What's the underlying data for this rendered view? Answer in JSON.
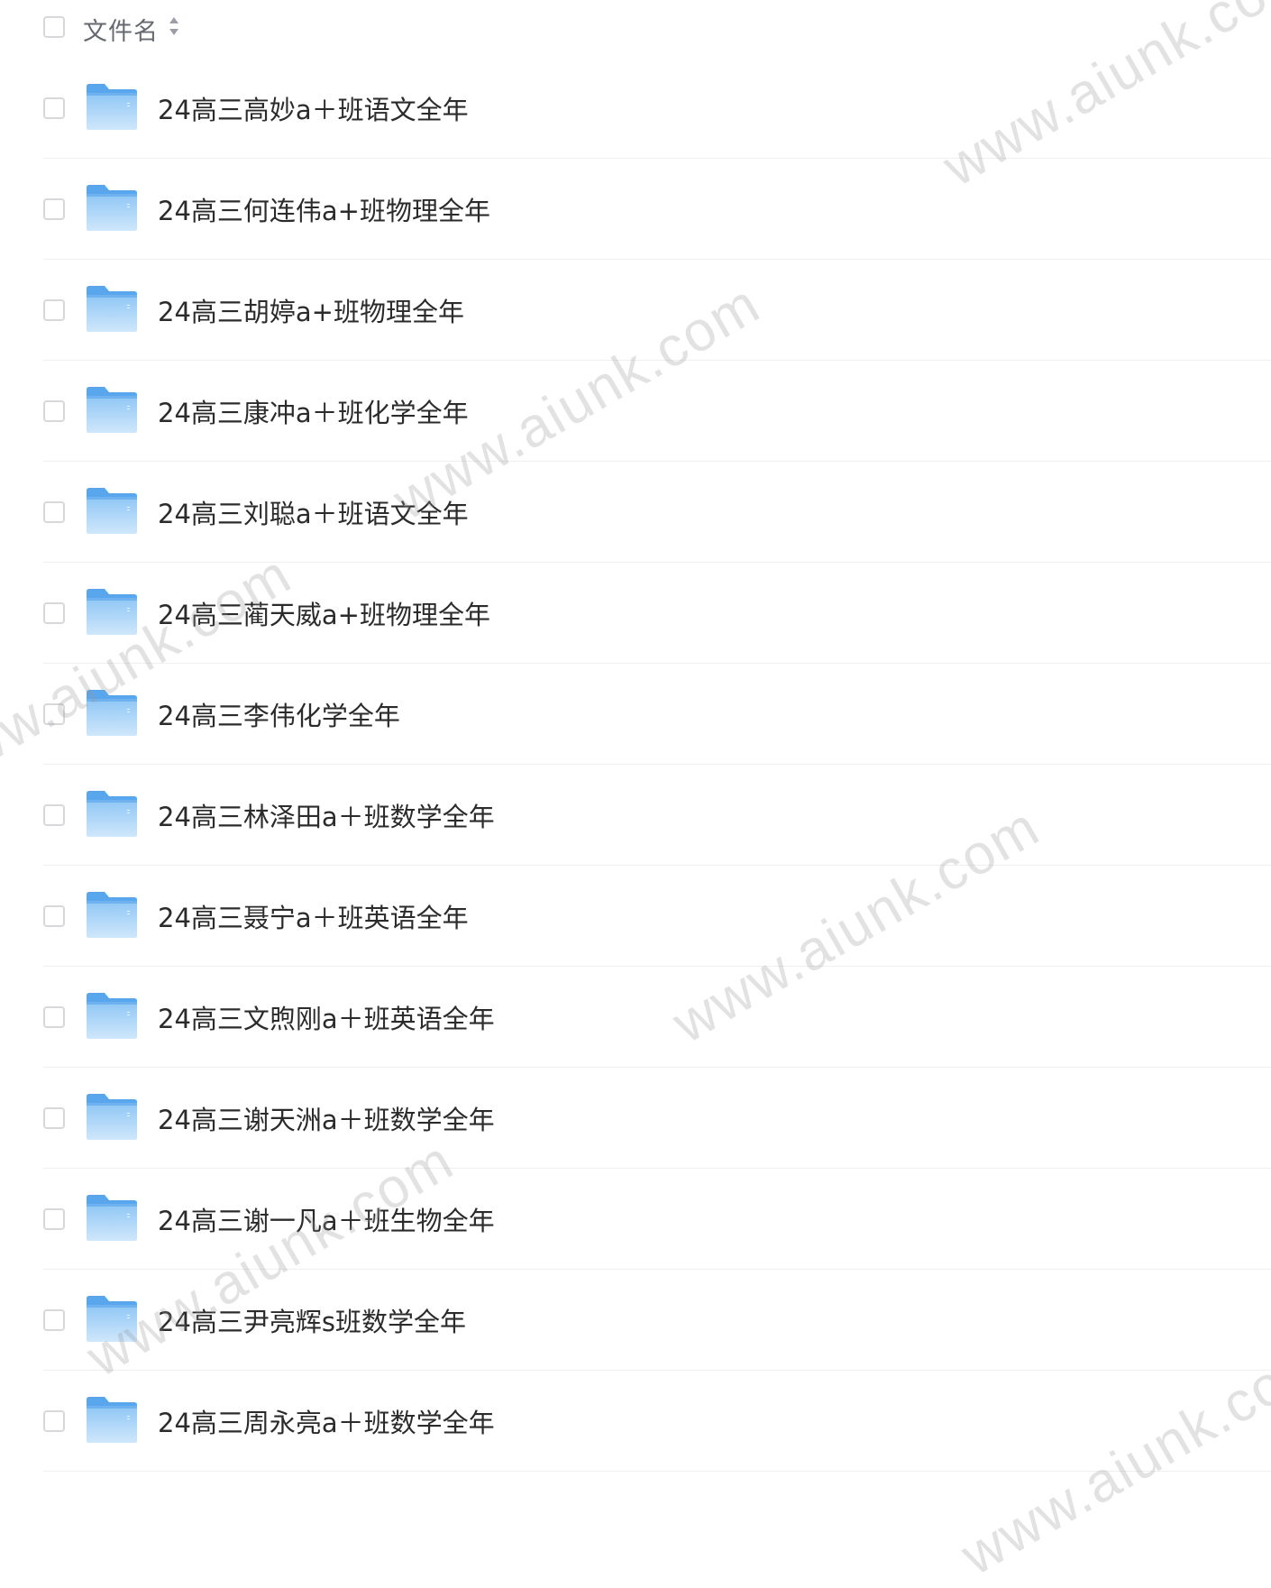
{
  "header": {
    "column_label": "文件名",
    "sort_icon": "sort-icon"
  },
  "files": [
    {
      "name": "24高三高妙a＋班语文全年",
      "icon": "folder-icon"
    },
    {
      "name": "24高三何连伟a+班物理全年",
      "icon": "folder-icon"
    },
    {
      "name": "24高三胡婷a+班物理全年",
      "icon": "folder-icon"
    },
    {
      "name": "24高三康冲a＋班化学全年",
      "icon": "folder-icon"
    },
    {
      "name": "24高三刘聪a＋班语文全年",
      "icon": "folder-icon"
    },
    {
      "name": "24高三蔺天威a+班物理全年",
      "icon": "folder-icon"
    },
    {
      "name": "24高三李伟化学全年",
      "icon": "folder-icon"
    },
    {
      "name": "24高三林泽田a＋班数学全年",
      "icon": "folder-icon"
    },
    {
      "name": "24高三聂宁a＋班英语全年",
      "icon": "folder-icon"
    },
    {
      "name": "24高三文煦刚a＋班英语全年",
      "icon": "folder-icon"
    },
    {
      "name": "24高三谢天洲a＋班数学全年",
      "icon": "folder-icon"
    },
    {
      "name": "24高三谢一凡a＋班生物全年",
      "icon": "folder-icon"
    },
    {
      "name": "24高三尹亮辉s班数学全年",
      "icon": "folder-icon"
    },
    {
      "name": "24高三周永亮a＋班数学全年",
      "icon": "folder-icon"
    }
  ],
  "watermark": {
    "text": "www.aiunk.com"
  }
}
